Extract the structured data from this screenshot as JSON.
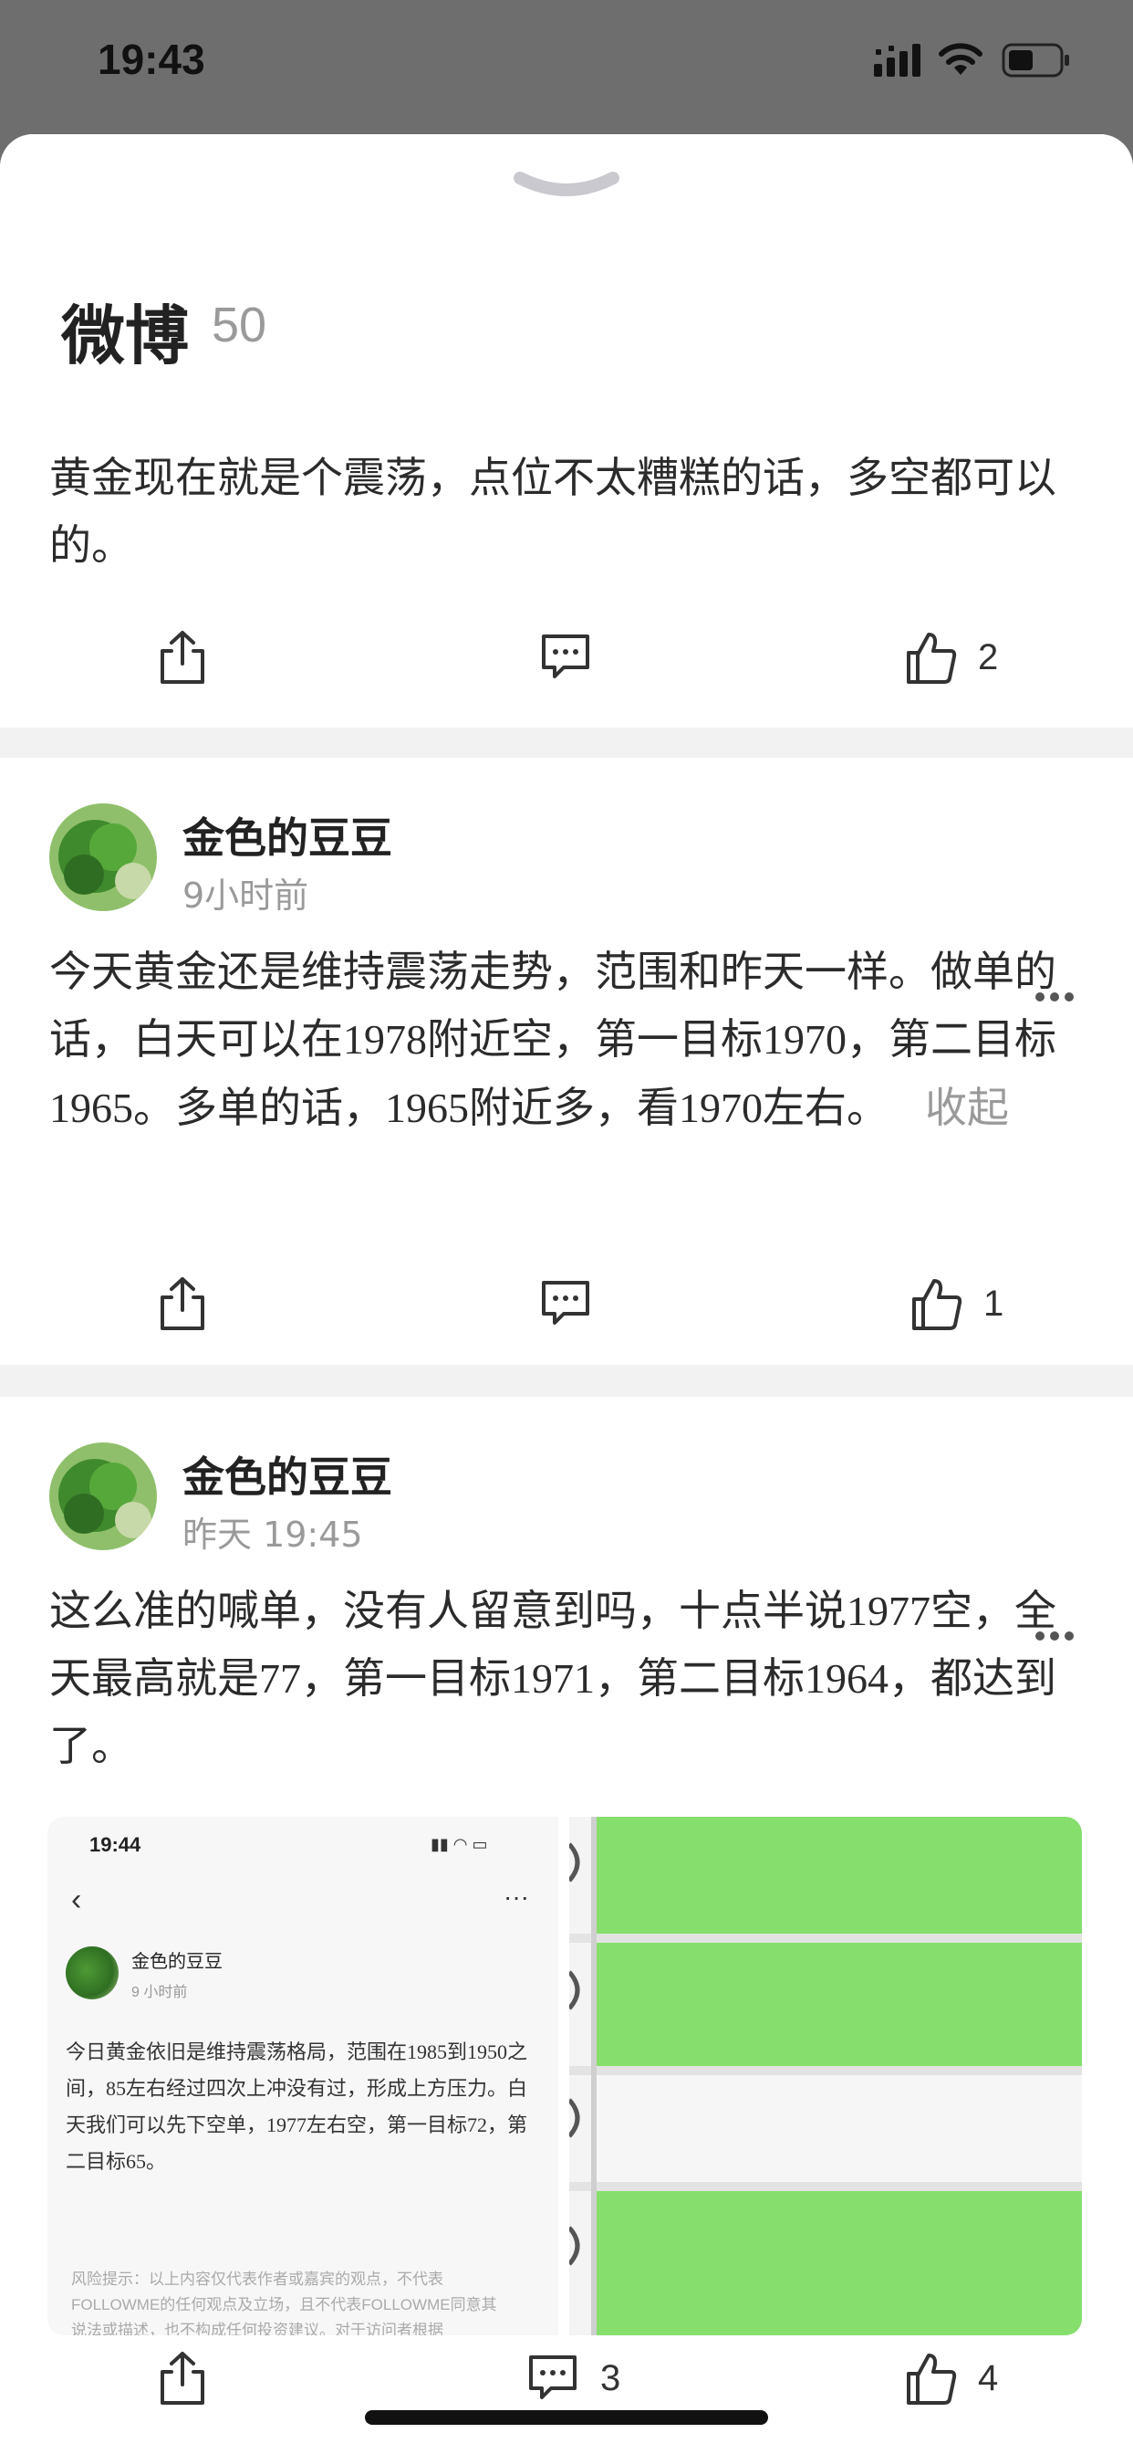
{
  "status": {
    "time": "19:43"
  },
  "sheet": {
    "title": "微博",
    "count": "50"
  },
  "posts": [
    {
      "text": "黄金现在就是个震荡，点位不太糟糕的话，多空都可以的。",
      "likes": "2"
    },
    {
      "user": "金色的豆豆",
      "time": "9小时前",
      "text": "今天黄金还是维持震荡走势，范围和昨天一样。做单的话，白天可以在1978附近空，第一目标1970，第二目标1965。多单的话，1965附近多，看1970左右。",
      "collapse_label": "收起",
      "likes": "1"
    },
    {
      "user": "金色的豆豆",
      "time": "昨天 19:45",
      "text": "这么准的喊单，没有人留意到吗，十点半说1977空，全天最高就是77，第一目标1971，第二目标1964，都达到了。",
      "comments": "3",
      "likes": "4",
      "screenshot": {
        "time": "19:44",
        "user": "金色的豆豆",
        "user_time": "9 小时前",
        "text": "今日黄金依旧是维持震荡格局，范围在1985到1950之间，85左右经过四次上冲没有过，形成上方压力。白天我们可以先下空单，1977左右空，第一目标72，第二目标65。",
        "risk_line1": "风险提示：以上内容仅代表作者或嘉宾的观点，不代表",
        "risk_line2": "FOLLOWME的任何观点及立场，且不代表FOLLOWME同意其",
        "risk_line3": "说法或描述，也不构成任何投资建议。对于访问者根据"
      }
    }
  ],
  "colors": {
    "accent_green": "#7fe06a",
    "sheet_bg": "#f2f2f2",
    "backdrop": "#6e6e6e"
  }
}
